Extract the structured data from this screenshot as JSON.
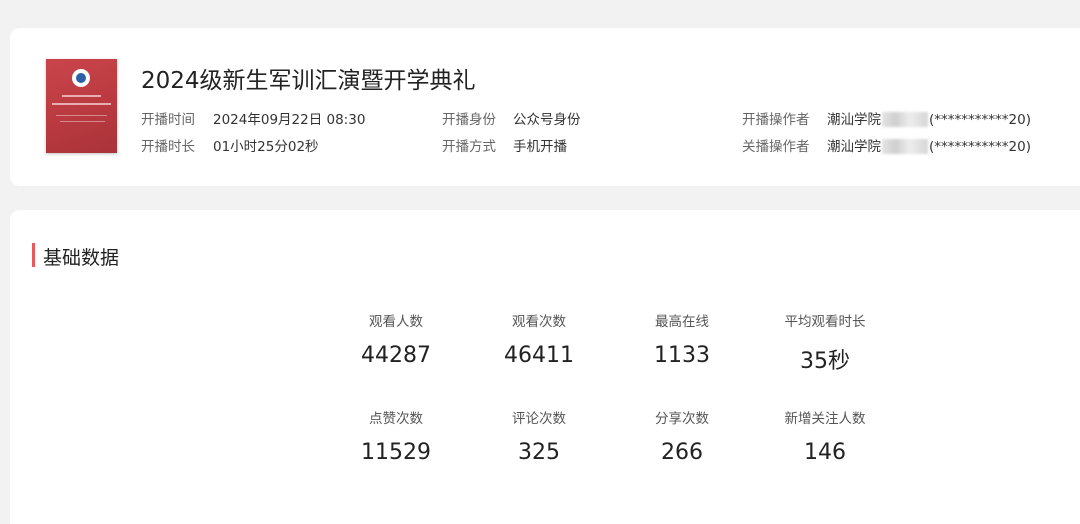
{
  "live": {
    "title": "2024级新生军训汇演暨开学典礼",
    "meta": {
      "start_time_label": "开播时间",
      "start_time_value": "2024年09月22日 08:30",
      "duration_label": "开播时长",
      "duration_value": "01小时25分02秒",
      "identity_label": "开播身份",
      "identity_value": "公众号身份",
      "method_label": "开播方式",
      "method_value": "手机开播",
      "start_operator_label": "开播操作者",
      "start_operator_prefix": "潮汕学院",
      "start_operator_suffix": "(***********20)",
      "stop_operator_label": "关播操作者",
      "stop_operator_prefix": "潮汕学院",
      "stop_operator_suffix": "(***********20)"
    }
  },
  "basic_data": {
    "section_title": "基础数据",
    "stats": [
      {
        "label": "观看人数",
        "value": "44287"
      },
      {
        "label": "观看次数",
        "value": "46411"
      },
      {
        "label": "最高在线",
        "value": "1133"
      },
      {
        "label": "平均观看时长",
        "value": "35秒"
      },
      {
        "label": "点赞次数",
        "value": "11529"
      },
      {
        "label": "评论次数",
        "value": "325"
      },
      {
        "label": "分享次数",
        "value": "266"
      },
      {
        "label": "新增关注人数",
        "value": "146"
      }
    ]
  },
  "colors": {
    "accent_bar": "#e8585c",
    "cover_red": "#c9454b",
    "background": "#f2f2f2"
  }
}
